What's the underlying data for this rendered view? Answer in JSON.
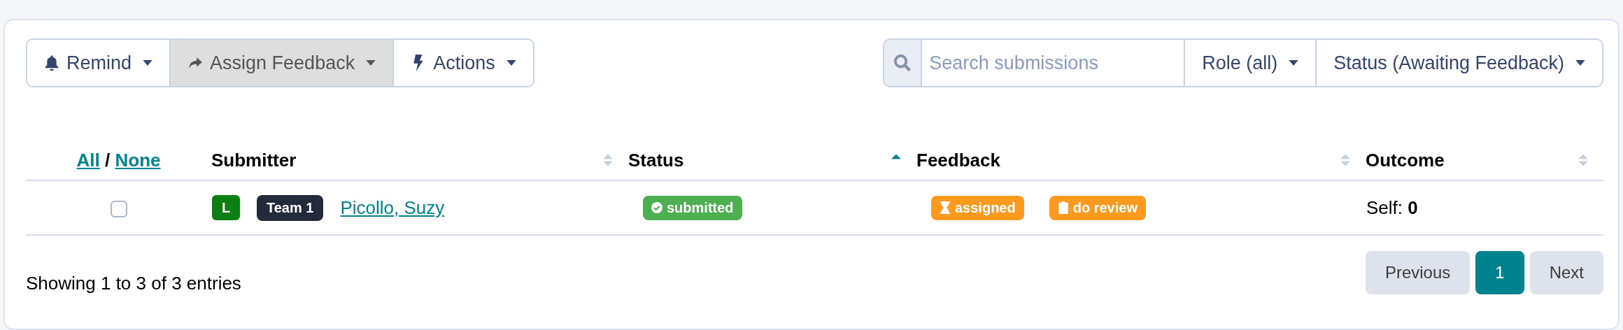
{
  "toolbar": {
    "buttons": [
      {
        "label": "Remind",
        "active": false
      },
      {
        "label": "Assign Feedback",
        "active": true
      },
      {
        "label": "Actions",
        "active": false
      }
    ]
  },
  "filters": {
    "search": {
      "placeholder": "Search submissions"
    },
    "dropdowns": [
      "Role (all)",
      "Status (Awaiting Feedback)"
    ]
  },
  "table": {
    "select_links": [
      "All",
      "None"
    ],
    "separator": "/",
    "columns": [
      {
        "label": "Submitter",
        "sorted": false
      },
      {
        "label": "Status",
        "sorted": true
      },
      {
        "label": "Feedback",
        "sorted": false
      },
      {
        "label": "Outcome",
        "sorted": false
      }
    ],
    "rows": [
      {
        "checked": false,
        "level_badge": {
          "text": "L",
          "color": "#0a7f12"
        },
        "team": "Team 1",
        "name": "Picollo, Suzy",
        "status": [
          {
            "text": "submitted",
            "color": "#4caf50"
          }
        ],
        "feedback": [
          {
            "text": "assigned",
            "color": "#ff9a1f"
          },
          {
            "text": "do review",
            "color": "#ff9a1f"
          }
        ],
        "outcome": {
          "label": "Self:",
          "value": "0"
        }
      }
    ]
  },
  "footer": {
    "info": "Showing 1 to 3 of 3 entries",
    "pagination": [
      {
        "label": "Previous",
        "selected": false
      },
      {
        "label": "1",
        "selected": true
      },
      {
        "label": "Next",
        "selected": false
      }
    ]
  }
}
